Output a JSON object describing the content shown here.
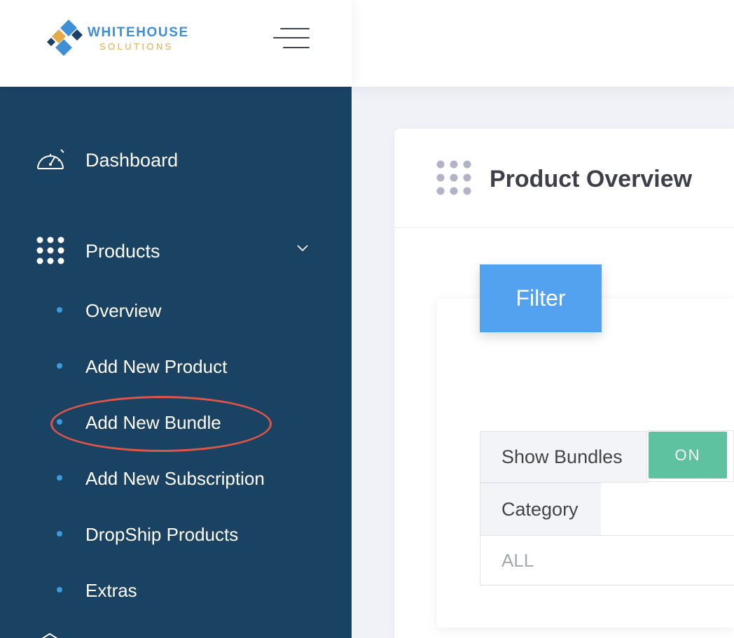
{
  "brand": {
    "name_line1": "WHITEHOUSE",
    "name_line2": "SOLUTIONS",
    "primary_color": "#3f8fd4",
    "accent_color": "#e4a949"
  },
  "sidebar": {
    "background": "#1a4263",
    "items": [
      {
        "label": "Dashboard",
        "icon": "speedometer-icon"
      },
      {
        "label": "Products",
        "icon": "grid-dots-icon",
        "expanded": true
      }
    ],
    "products_submenu": [
      {
        "label": "Overview"
      },
      {
        "label": "Add New Product"
      },
      {
        "label": "Add New Bundle",
        "highlighted": true
      },
      {
        "label": "Add New Subscription"
      },
      {
        "label": "DropShip Products"
      },
      {
        "label": "Extras"
      }
    ]
  },
  "main": {
    "title": "Product Overview",
    "filter_button": "Filter",
    "show_bundles_label": "Show Bundles",
    "show_bundles_toggle": "ON",
    "category_label": "Category",
    "category_value": "ALL"
  }
}
